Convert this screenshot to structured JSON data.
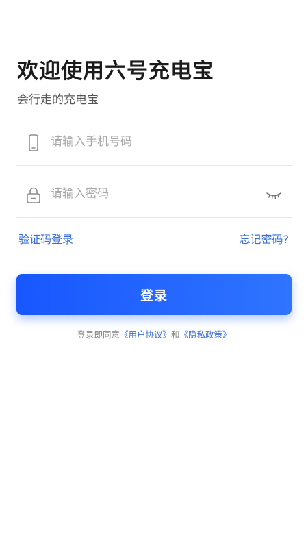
{
  "header": {
    "title": "欢迎使用六号充电宝",
    "subtitle": "会行走的充电宝"
  },
  "form": {
    "phone": {
      "placeholder": "请输入手机号码",
      "icon": "phone-icon"
    },
    "password": {
      "placeholder": "请输入密码",
      "icon": "lock-icon",
      "toggle_icon": "eye-closed-icon"
    }
  },
  "links": {
    "sms_login": "验证码登录",
    "forgot_password": "忘记密码?"
  },
  "login_button": {
    "label": "登录"
  },
  "agreement": {
    "prefix": "登录即同意",
    "user_agreement": "《用户协议》",
    "conjunction": "和",
    "privacy_policy": "《隐私政策》"
  },
  "colors": {
    "accent": "#1857ff",
    "link": "#3b6fd6",
    "placeholder": "#a8a8a8",
    "divider": "#e6e6e6"
  }
}
